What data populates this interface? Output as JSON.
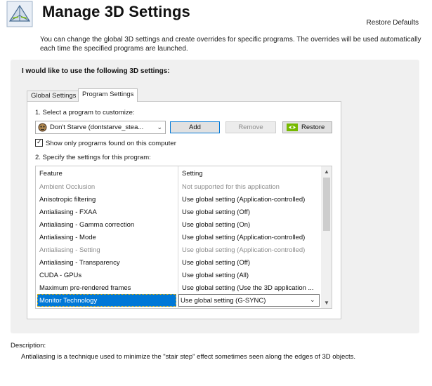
{
  "header": {
    "title": "Manage 3D Settings",
    "restore_defaults": "Restore Defaults"
  },
  "intro": "You can change the global 3D settings and create overrides for specific programs. The overrides will be used automatically each time the specified programs are launched.",
  "panel": {
    "heading": "I would like to use the following 3D settings:",
    "tabs": [
      {
        "label": "Global Settings",
        "selected": false
      },
      {
        "label": "Program Settings",
        "selected": true
      }
    ],
    "step1_label": "1. Select a program to customize:",
    "program_select": {
      "value": "Don't Starve (dontstarve_stea...",
      "icon": "game-icon"
    },
    "buttons": {
      "add": "Add",
      "remove": "Remove",
      "restore": "Restore"
    },
    "checkbox": {
      "label": "Show only programs found on this computer",
      "checked": true
    },
    "step2_label": "2. Specify the settings for this program:",
    "grid": {
      "columns": [
        "Feature",
        "Setting"
      ],
      "rows": [
        {
          "feature": "Ambient Occlusion",
          "setting": "Not supported for this application",
          "disabled": true
        },
        {
          "feature": "Anisotropic filtering",
          "setting": "Use global setting (Application-controlled)",
          "disabled": false
        },
        {
          "feature": "Antialiasing - FXAA",
          "setting": "Use global setting (Off)",
          "disabled": false
        },
        {
          "feature": "Antialiasing - Gamma correction",
          "setting": "Use global setting (On)",
          "disabled": false
        },
        {
          "feature": "Antialiasing - Mode",
          "setting": "Use global setting (Application-controlled)",
          "disabled": false
        },
        {
          "feature": "Antialiasing - Setting",
          "setting": "Use global setting (Application-controlled)",
          "disabled": true
        },
        {
          "feature": "Antialiasing - Transparency",
          "setting": "Use global setting (Off)",
          "disabled": false
        },
        {
          "feature": "CUDA - GPUs",
          "setting": "Use global setting (All)",
          "disabled": false
        },
        {
          "feature": "Maximum pre-rendered frames",
          "setting": "Use global setting (Use the 3D application ...",
          "disabled": false
        },
        {
          "feature": "Monitor Technology",
          "setting": "Use global setting (G-SYNC)",
          "disabled": false,
          "selected": true
        }
      ]
    }
  },
  "description": {
    "label": "Description:",
    "text": "Antialiasing is a technique used to minimize the \"stair step\" effect sometimes seen along the edges of 3D objects."
  },
  "colors": {
    "selection": "#0078d7",
    "nvidia_green": "#76b900",
    "panel_bg": "#f0f0f0"
  }
}
